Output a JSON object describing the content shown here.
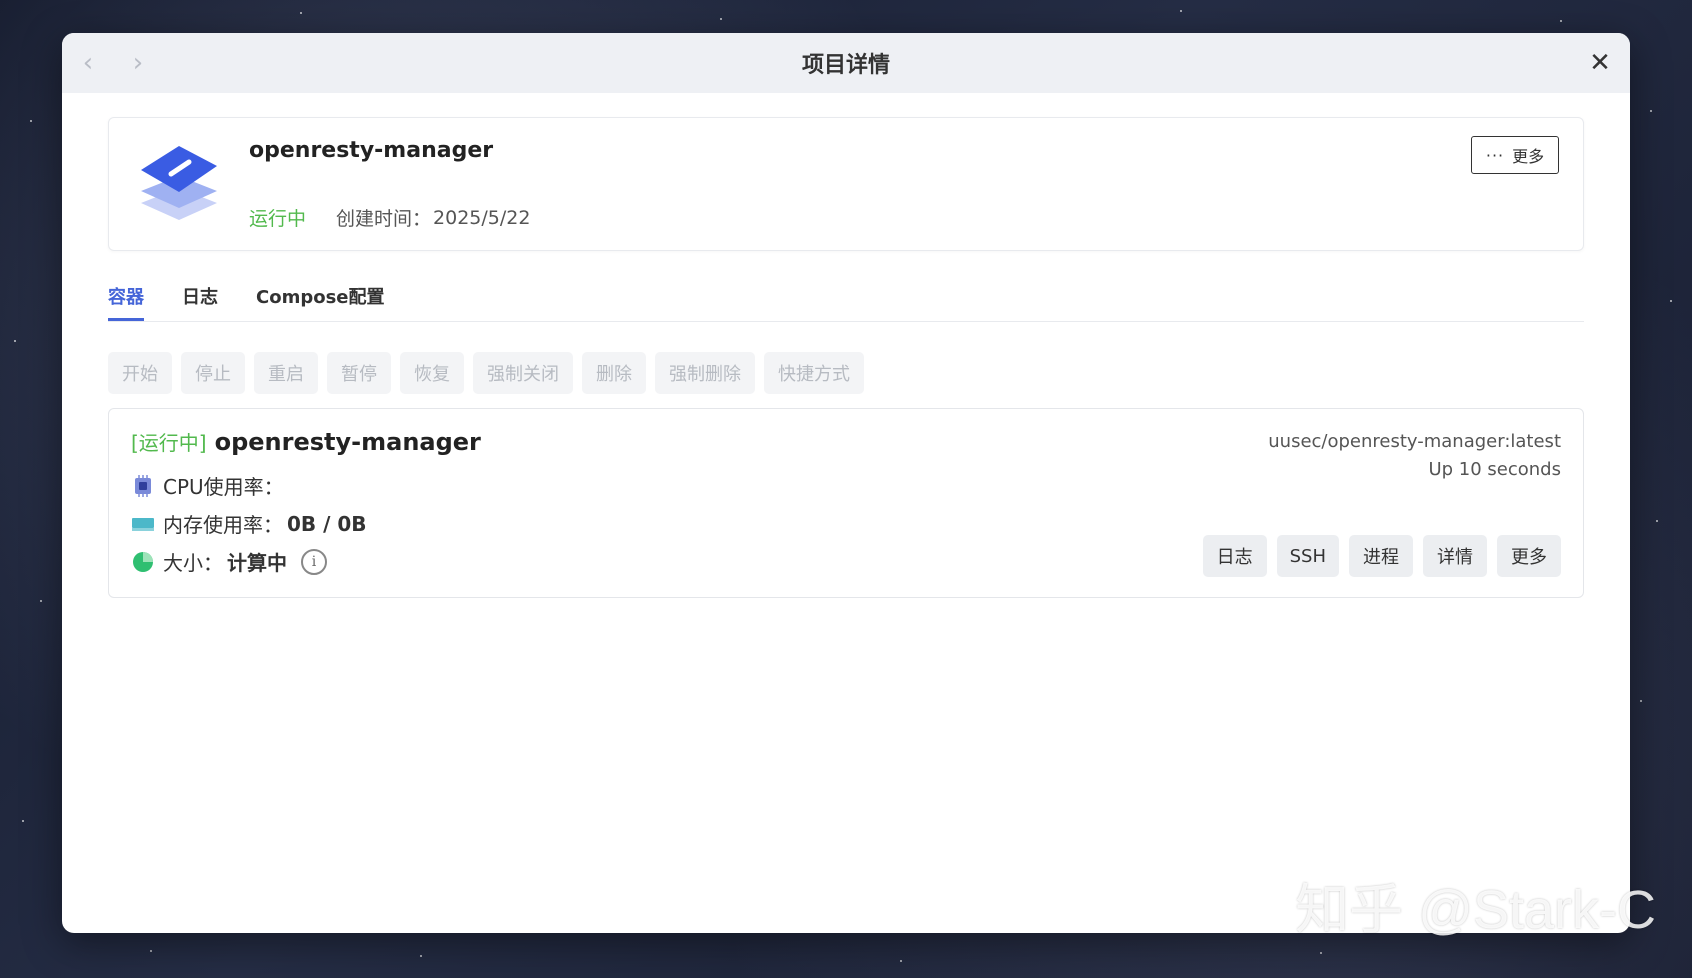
{
  "window": {
    "title": "项目详情",
    "close_glyph": "✕",
    "back_glyph": "‹",
    "forward_glyph": "›"
  },
  "project": {
    "name": "openresty-manager",
    "status": "运行中",
    "created_label": "创建时间：",
    "created_value": "2025/5/22",
    "more_label": "更多",
    "more_dots": "···"
  },
  "tabs": [
    {
      "label": "容器",
      "active": true
    },
    {
      "label": "日志",
      "active": false
    },
    {
      "label": "Compose配置",
      "active": false
    }
  ],
  "actions": [
    {
      "label": "开始"
    },
    {
      "label": "停止"
    },
    {
      "label": "重启"
    },
    {
      "label": "暂停"
    },
    {
      "label": "恢复"
    },
    {
      "label": "强制关闭"
    },
    {
      "label": "删除"
    },
    {
      "label": "强制删除"
    },
    {
      "label": "快捷方式"
    }
  ],
  "container": {
    "status": "[运行中]",
    "name": "openresty-manager",
    "image": "uusec/openresty-manager:latest",
    "uptime": "Up 10 seconds",
    "cpu_label": "CPU使用率：",
    "cpu_value": "",
    "mem_label": "内存使用率：",
    "mem_value": "0B / 0B",
    "size_label": "大小：",
    "size_value": "计算中",
    "info_glyph": "i",
    "buttons": [
      {
        "label": "日志"
      },
      {
        "label": "SSH"
      },
      {
        "label": "进程"
      },
      {
        "label": "详情"
      },
      {
        "label": "更多"
      }
    ]
  },
  "watermark": "知乎 @Stark-C",
  "colors": {
    "accent": "#4565d8",
    "running": "#52b94d"
  }
}
